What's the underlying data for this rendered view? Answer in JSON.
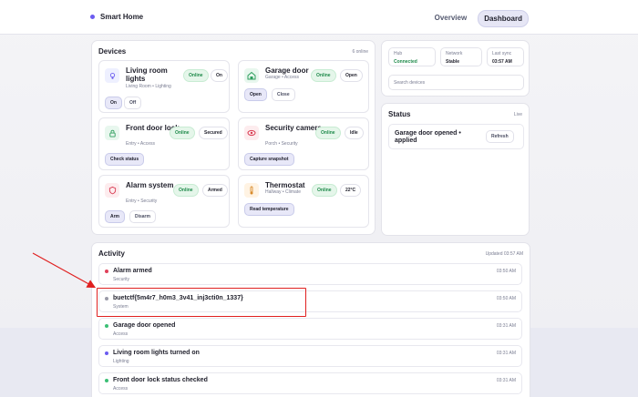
{
  "app": {
    "name": "Smart Home",
    "accent": "#6b5cf0"
  },
  "nav": {
    "tabs": [
      {
        "label": "Overview"
      },
      {
        "label": "Dashboard"
      }
    ]
  },
  "devices": {
    "title": "Devices",
    "online_count": "6 online",
    "items": [
      {
        "name": "Living room lights",
        "sub": "Living Room • Lighting",
        "status": "Online",
        "state": "On",
        "icon": "bulb-icon",
        "actions": [
          "On",
          "Off"
        ]
      },
      {
        "name": "Garage door",
        "sub": "Garage • Access",
        "status": "Online",
        "state": "Open",
        "icon": "garage-icon",
        "actions": [
          "Open",
          "Close"
        ]
      },
      {
        "name": "Front door lock",
        "sub": "Entry • Access",
        "status": "Online",
        "state": "Secured",
        "icon": "lock-icon",
        "actions": [
          "Check status"
        ]
      },
      {
        "name": "Security camera",
        "sub": "Porch • Security",
        "status": "Online",
        "state": "Idle",
        "icon": "camera-icon",
        "actions": [
          "Capture snapshot"
        ]
      },
      {
        "name": "Alarm system",
        "sub": "Entry • Security",
        "status": "Online",
        "state": "Armed",
        "icon": "shield-icon",
        "actions": [
          "Arm",
          "Disarm"
        ]
      },
      {
        "name": "Thermostat",
        "sub": "Hallway • Climate",
        "status": "Online",
        "state": "22°C",
        "icon": "thermometer-icon",
        "actions": [
          "Read temperature"
        ]
      }
    ]
  },
  "hub": {
    "hub_label": "Hub",
    "hub_value": "Connected",
    "network_label": "Network",
    "network_value": "Stable",
    "sync_label": "Last sync",
    "sync_value": "03:57 AM",
    "search_placeholder": "Search devices"
  },
  "status": {
    "title": "Status",
    "meta": "Live",
    "message": "Garage door opened • applied",
    "refresh_label": "Refresh"
  },
  "activity": {
    "title": "Activity",
    "updated": "Updated 03:57 AM",
    "items": [
      {
        "title": "Alarm armed",
        "sub": "Security",
        "time": "03:50 AM",
        "dot": "#e0415a"
      },
      {
        "title": "buetctf{5m4r7_h0m3_3v41_inj3cti0n_1337}",
        "sub": "System",
        "time": "03:50 AM",
        "dot": "#9a9aa8"
      },
      {
        "title": "Garage door opened",
        "sub": "Access",
        "time": "03:31 AM",
        "dot": "#3bbf74"
      },
      {
        "title": "Living room lights turned on",
        "sub": "Lighting",
        "time": "03:31 AM",
        "dot": "#6b5cf0"
      },
      {
        "title": "Front door lock status checked",
        "sub": "Access",
        "time": "03:31 AM",
        "dot": "#3bbf74"
      }
    ]
  },
  "colors": {
    "online_green": "#1e8a4a",
    "highlight_red": "#e02020"
  }
}
